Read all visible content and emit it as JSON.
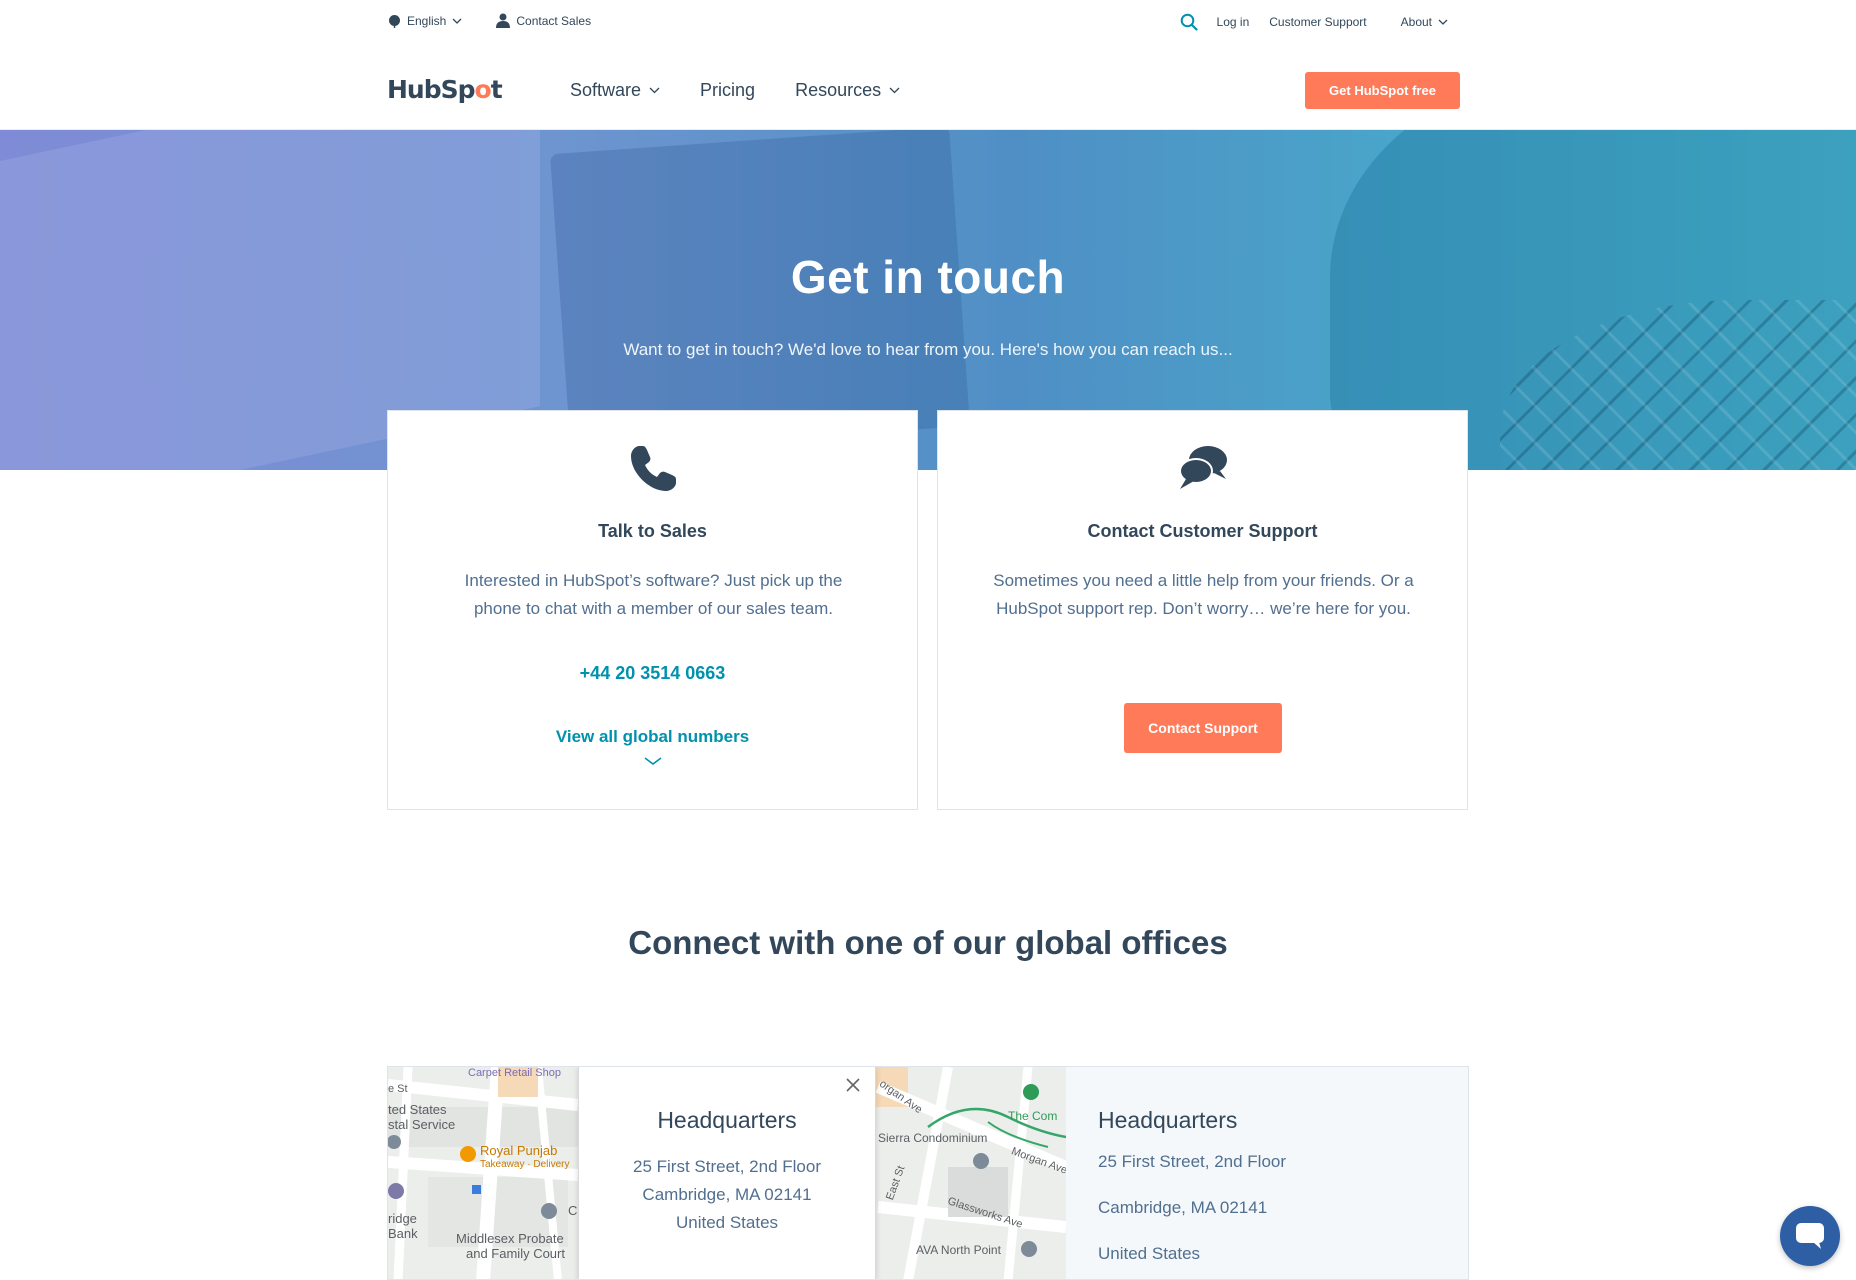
{
  "colors": {
    "accent": "#ff7a59",
    "link": "#0091ae",
    "text_dark": "#33475b",
    "text_body": "#516f90",
    "chat_button": "#2e5ea4"
  },
  "utility_bar": {
    "language": "English",
    "contact_sales": "Contact Sales",
    "login": "Log in",
    "customer_support": "Customer Support",
    "about": "About"
  },
  "nav": {
    "logo_text_a": "HubSp",
    "logo_text_b": "o",
    "logo_text_c": "t",
    "links": [
      "Software",
      "Pricing",
      "Resources"
    ],
    "cta": "Get HubSpot free"
  },
  "hero": {
    "title": "Get in touch",
    "subtitle": "Want to get in touch? We'd love to hear from you. Here's how you can reach us..."
  },
  "cards": {
    "sales": {
      "icon": "phone-icon",
      "title": "Talk to Sales",
      "text": "Interested in HubSpot’s software? Just pick up the phone to chat with a member of our sales team.",
      "phone": "+44 20 3514 0663",
      "global_link": "View all global numbers"
    },
    "support": {
      "icon": "chat-bubbles-icon",
      "title": "Contact Customer Support",
      "text": "Sometimes you need a little help from your friends. Or a HubSpot support rep. Don’t worry… we’re here for you.",
      "button": "Contact Support"
    }
  },
  "offices": {
    "heading": "Connect with one of our global offices",
    "map_labels": {
      "carpet": "Carpet Retail Shop",
      "e_st": "e St",
      "usps_1": "ted States",
      "usps_2": "stal Service",
      "royal_punjab": "Royal Punjab",
      "takeaway": "Takeaway · Delivery",
      "bridge_1": "ridge",
      "bridge_2": "Bank",
      "middlesex_1": "Middlesex Probate",
      "middlesex_2": "and Family Court",
      "c_letter": "C",
      "morgan_ave": "organ Ave",
      "the_com": "The Com",
      "sierra": "Sierra Condominium",
      "morgan_ave_2": "Morgan Ave",
      "east_st": "East St",
      "glassworks": "Glassworks Ave",
      "ava": "AVA North Point"
    },
    "info_window": {
      "title": "Headquarters",
      "line1": "25 First Street, 2nd Floor",
      "line2": "Cambridge, MA 02141",
      "line3": "United States"
    },
    "office": {
      "title": "Headquarters",
      "line1": "25 First Street, 2nd Floor",
      "line2": "Cambridge, MA 02141",
      "line3": "United States"
    }
  }
}
